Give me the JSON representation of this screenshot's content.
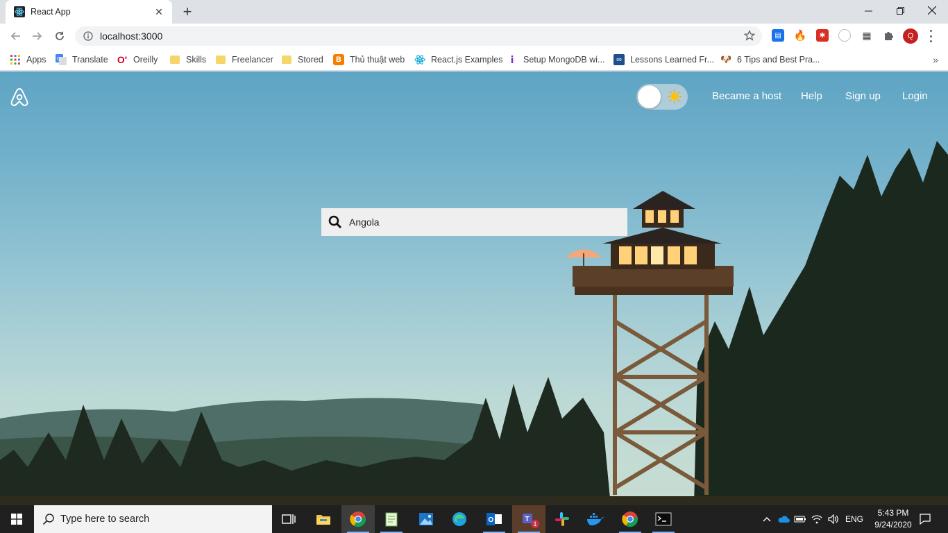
{
  "browser": {
    "tab_title": "React App",
    "url": "localhost:3000",
    "profile_initial": "Q"
  },
  "bookmarks": [
    {
      "label": "Apps"
    },
    {
      "label": "Translate"
    },
    {
      "label": "Oreilly"
    },
    {
      "label": "Skills"
    },
    {
      "label": "Freelancer"
    },
    {
      "label": "Stored"
    },
    {
      "label": "Thủ thuật web"
    },
    {
      "label": "React.js Examples"
    },
    {
      "label": "Setup MongoDB wi..."
    },
    {
      "label": "Lessons Learned Fr..."
    },
    {
      "label": "6 Tips and Best Pra..."
    }
  ],
  "site": {
    "nav": {
      "host": "Became a host",
      "help": "Help",
      "signup": "Sign up",
      "login": "Login"
    },
    "theme_toggle": "light",
    "search_value": "Angola"
  },
  "taskbar": {
    "search_placeholder": "Type here to search",
    "language": "ENG",
    "time": "5:43 PM",
    "date": "9/24/2020",
    "teams_badge": "1"
  },
  "colors": {
    "accent_profile": "#c5221f",
    "sky_top": "#5ea4c4",
    "taskbar": "#202020"
  }
}
